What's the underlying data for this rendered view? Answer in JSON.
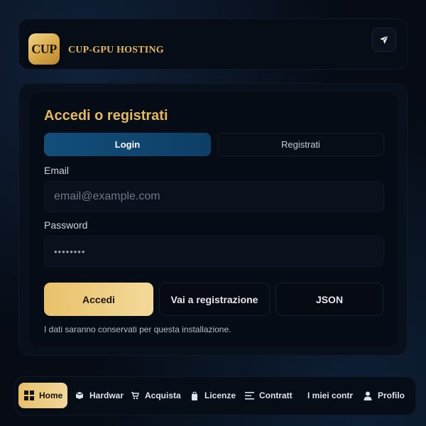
{
  "header": {
    "logo_text": "CUP",
    "brand": "CUP-GPU HOSTING",
    "send_icon": "paper-plane-icon"
  },
  "card": {
    "title": "Accedi o registrati",
    "tabs": [
      {
        "label": "Login",
        "active": true
      },
      {
        "label": "Registrati",
        "active": false
      }
    ],
    "email": {
      "label": "Email",
      "placeholder": "email@example.com",
      "value": ""
    },
    "password": {
      "label": "Password",
      "value": "••••••••"
    },
    "buttons": {
      "primary": "Accedi",
      "secondary": "Vai a registrazione",
      "json": "JSON"
    },
    "note": "I dati saranno conservati per questa installazione."
  },
  "nav": {
    "items": [
      {
        "label": "Home",
        "icon": "grid-icon",
        "active": true
      },
      {
        "label": "Hardwar",
        "icon": "box-icon",
        "active": false
      },
      {
        "label": "Acquista",
        "icon": "cart-icon",
        "active": false
      },
      {
        "label": "Licenze",
        "icon": "bag-icon",
        "active": false
      },
      {
        "label": "Contratt",
        "icon": "list-icon",
        "active": false
      },
      {
        "label": "I miei contr",
        "icon": "",
        "active": false
      },
      {
        "label": "Profilo",
        "icon": "user-icon",
        "active": false
      }
    ]
  },
  "colors": {
    "accent_gold": "#e5b95c",
    "tab_active_blue": "#114e7a",
    "background": "#060b14"
  }
}
